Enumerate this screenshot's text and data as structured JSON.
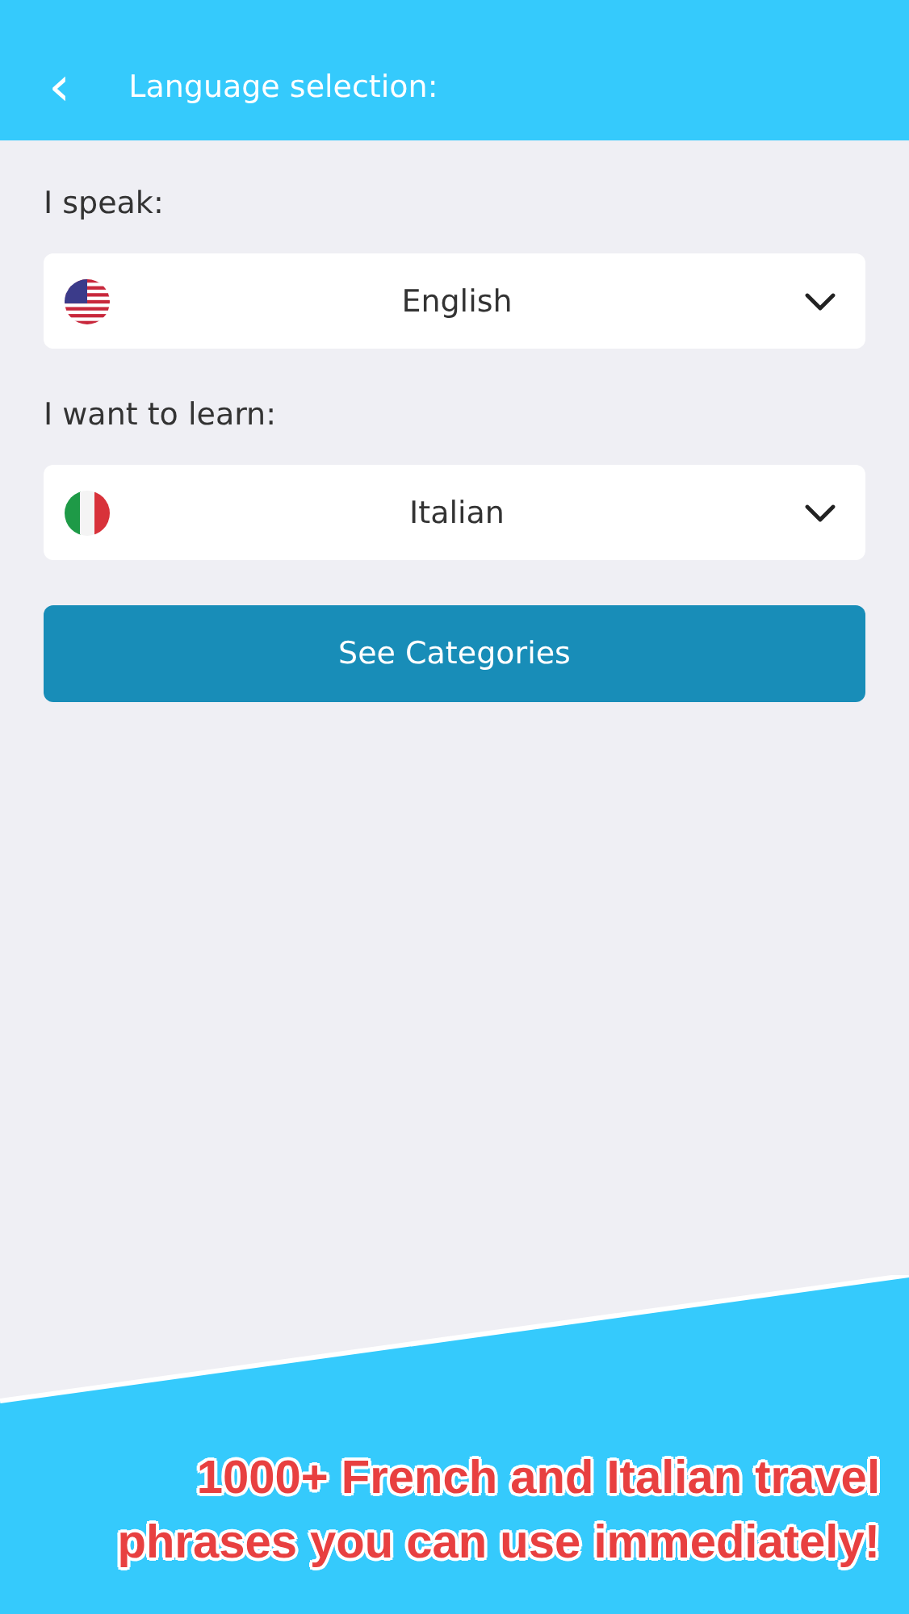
{
  "header": {
    "back_icon": "‹",
    "title": "Language selection:"
  },
  "pickers": [
    {
      "label": "I speak:",
      "kind": "us",
      "value": "English"
    },
    {
      "label": "I want to learn:",
      "kind": "italy",
      "value": "Italian"
    }
  ],
  "action_button": "See Categories",
  "caption": [
    "1000+ French and Italian travel",
    "phrases you can use immediately!"
  ]
}
